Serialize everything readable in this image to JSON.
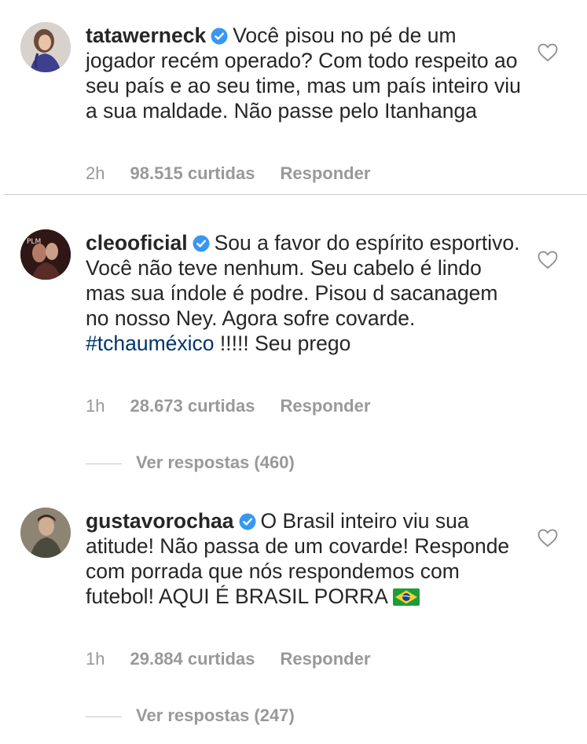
{
  "colors": {
    "text": "#262626",
    "meta": "#999999",
    "hashtag": "#003569",
    "verified": "#3897f0"
  },
  "comments": [
    {
      "username": "tatawerneck",
      "verified": true,
      "text": "Você pisou no pé de um jogador recém operado? Com todo respeito ao seu país e ao seu time, mas um país inteiro viu a sua maldade. Não passe pelo Itanhanga",
      "time": "2h",
      "likes": "98.515 curtidas",
      "reply_label": "Responder",
      "icons": [
        "verified-badge-icon",
        "heart-icon"
      ]
    },
    {
      "username": "cleooficial",
      "verified": true,
      "text_before": "Sou a favor do espírito esportivo. Você não teve nenhum. Seu cabelo é lindo mas sua índole é podre. Pisou d sacanagem no nosso Ney. Agora sofre covarde.",
      "hashtag": "#tchauméxico",
      "text_after": "!!!!! Seu prego",
      "time": "1h",
      "likes": "28.673 curtidas",
      "reply_label": "Responder",
      "view_replies": "Ver respostas (460)",
      "icons": [
        "verified-badge-icon",
        "heart-icon"
      ]
    },
    {
      "username": "gustavorochaa",
      "verified": true,
      "text": "O Brasil inteiro viu sua atitude! Não passa de um covarde! Responde com porrada que nós respondemos com futebol! AQUI É BRASIL PORRA",
      "emoji": "brazil-flag-icon",
      "time": "1h",
      "likes": "29.884 curtidas",
      "reply_label": "Responder",
      "view_replies": "Ver respostas (247)",
      "icons": [
        "verified-badge-icon",
        "heart-icon"
      ]
    }
  ]
}
